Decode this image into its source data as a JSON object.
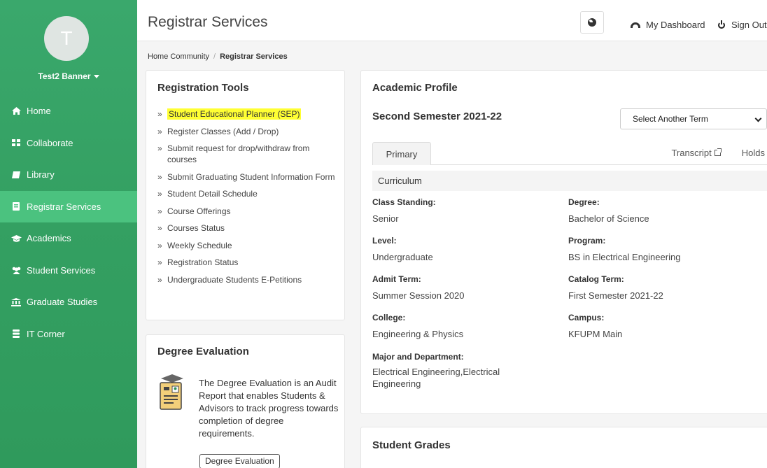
{
  "sidebar": {
    "avatar_initial": "T",
    "user_name": "Test2 Banner",
    "items": [
      {
        "label": "Home",
        "icon": "home-icon"
      },
      {
        "label": "Collaborate",
        "icon": "grid-icon"
      },
      {
        "label": "Library",
        "icon": "book-icon"
      },
      {
        "label": "Registrar Services",
        "icon": "bookmark-icon",
        "active": true
      },
      {
        "label": "Academics",
        "icon": "graduation-cap-icon"
      },
      {
        "label": "Student Services",
        "icon": "users-icon"
      },
      {
        "label": "Graduate Studies",
        "icon": "institution-icon"
      },
      {
        "label": "IT Corner",
        "icon": "database-icon"
      }
    ],
    "bg_color": "#34a062",
    "active_color": "#4bc27f"
  },
  "header": {
    "title": "Registrar Services",
    "dashboard_label": "My Dashboard",
    "signout_label": "Sign Out"
  },
  "breadcrumb": {
    "home": "Home Community",
    "current": "Registrar Services"
  },
  "registration_tools": {
    "title": "Registration Tools",
    "links": [
      "Student Educational Planner (SEP)",
      "Register Classes (Add / Drop)",
      "Submit request for drop/withdraw from courses",
      "Submit Graduating Student Information Form",
      "Student Detail Schedule",
      "Course Offerings",
      "Courses Status",
      "Weekly Schedule",
      "Registration Status",
      "Undergraduate Students E-Petitions"
    ],
    "highlight_color": "#ffff33"
  },
  "degree_evaluation": {
    "title": "Degree Evaluation",
    "description": "The Degree Evaluation is an Audit Report that enables Students & Advisors to track progress towards completion of degree requirements.",
    "button_label": "Degree Evaluation"
  },
  "academic_profile": {
    "title": "Academic Profile",
    "term": "Second Semester 2021-22",
    "select_label": "Select Another Term",
    "tab_label": "Primary",
    "transcript_label": "Transcript",
    "holds_label": "Holds",
    "section_label": "Curriculum",
    "fields": {
      "class_standing": {
        "label": "Class Standing:",
        "value": "Senior"
      },
      "degree": {
        "label": "Degree:",
        "value": "Bachelor of Science"
      },
      "level": {
        "label": "Level:",
        "value": "Undergraduate"
      },
      "program": {
        "label": "Program:",
        "value": "BS in Electrical Engineering"
      },
      "admit_term": {
        "label": "Admit Term:",
        "value": "Summer Session 2020"
      },
      "catalog_term": {
        "label": "Catalog Term:",
        "value": "First Semester 2021-22"
      },
      "college": {
        "label": "College:",
        "value": "Engineering & Physics"
      },
      "campus": {
        "label": "Campus:",
        "value": "KFUPM Main"
      },
      "major": {
        "label": "Major and Department:",
        "value": "Electrical Engineering,Electrical Engineering"
      }
    }
  },
  "student_grades": {
    "title": "Student Grades"
  }
}
